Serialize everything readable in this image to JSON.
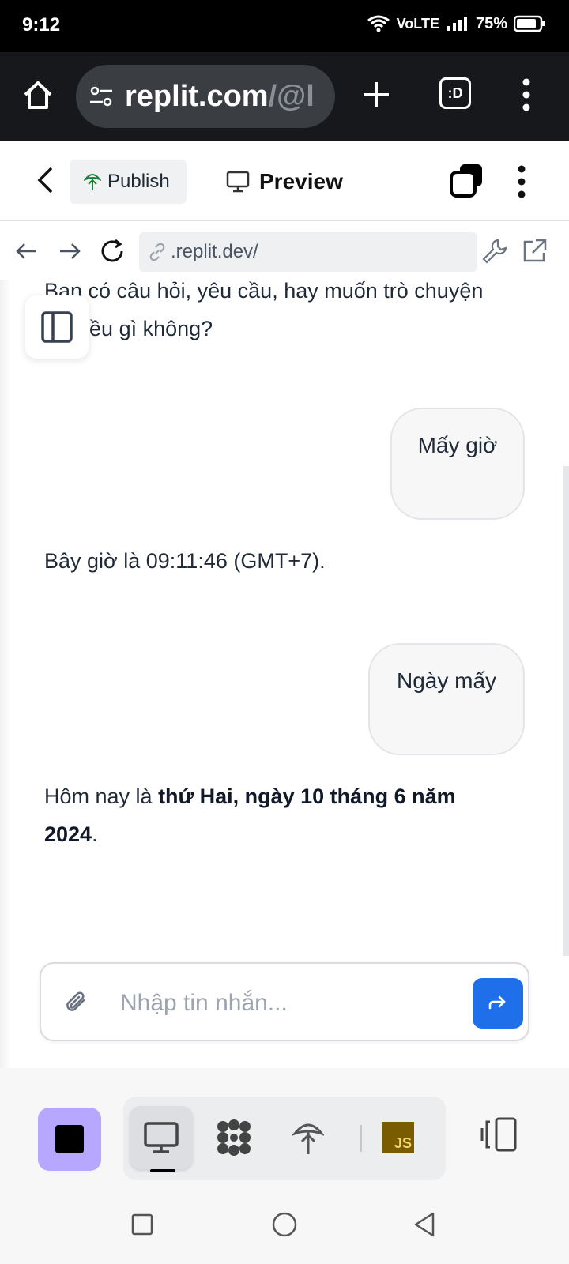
{
  "status_bar": {
    "time": "9:12",
    "network_label": "VoLTE",
    "battery": "75%"
  },
  "browser": {
    "url_host": "replit.com",
    "url_path": "/@l",
    "tabs_label": ":D"
  },
  "replit_header": {
    "publish_label": "Publish",
    "preview_label": "Preview"
  },
  "preview_toolbar": {
    "url": ".replit.dev/"
  },
  "chat": {
    "messages": [
      {
        "role": "assistant",
        "text": "Bạn có câu hỏi, yêu cầu, hay muốn trò chuyện về điều gì không?"
      },
      {
        "role": "user",
        "text": "Mấy giờ"
      },
      {
        "role": "assistant",
        "text": "Bây giờ là 09:11:46 (GMT+7)."
      },
      {
        "role": "user",
        "text": "Ngày mấy"
      },
      {
        "role": "assistant",
        "text_before": "Hôm nay là ",
        "text_bold": "thứ Hai, ngày 10 tháng 6 năm 2024",
        "text_after": "."
      }
    ]
  },
  "composer": {
    "placeholder": "Nhập tin nhắn..."
  },
  "dock": {
    "js_label": "JS"
  },
  "colors": {
    "send_button": "#1f6feb",
    "stop_button": "#b8a7ff",
    "js_badge": "#7a5c00"
  }
}
